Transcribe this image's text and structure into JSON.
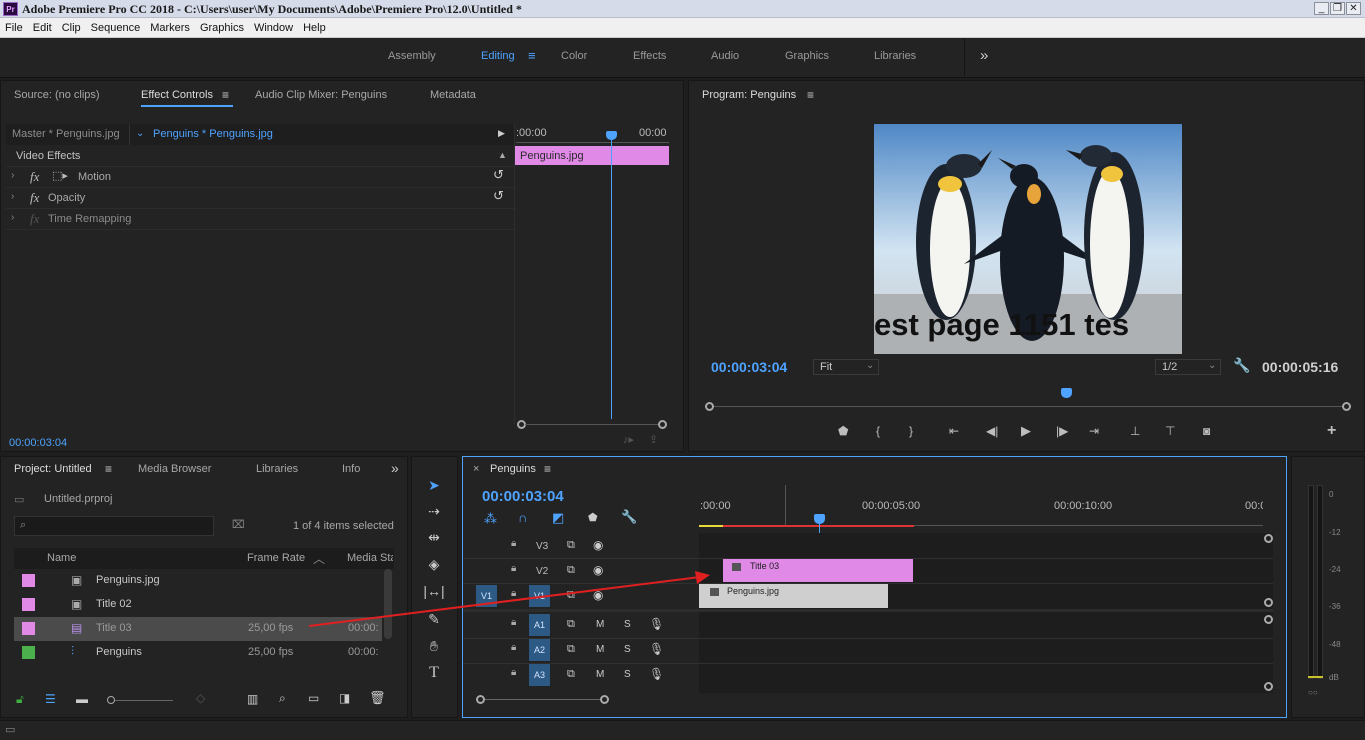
{
  "window": {
    "title": "Adobe Premiere Pro CC 2018 - C:\\Users\\user\\My Documents\\Adobe\\Premiere Pro\\12.0\\Untitled *",
    "logo": "Pr",
    "minimize": "_",
    "restore": "❐",
    "close": "✕"
  },
  "menu": [
    "File",
    "Edit",
    "Clip",
    "Sequence",
    "Markers",
    "Graphics",
    "Window",
    "Help"
  ],
  "workspaces": {
    "items": [
      "Assembly",
      "Editing",
      "Color",
      "Effects",
      "Audio",
      "Graphics",
      "Libraries"
    ],
    "active": "Editing",
    "more": "»"
  },
  "source_panel": {
    "tabs": [
      "Source: (no clips)",
      "Effect Controls",
      "Audio Clip Mixer: Penguins",
      "Metadata"
    ],
    "active_tab": "Effect Controls",
    "master": "Master * Penguins.jpg",
    "clip": "Penguins * Penguins.jpg",
    "section": "Video Effects",
    "effects": [
      "Motion",
      "Opacity",
      "Time Remapping"
    ],
    "fx": "fx",
    "ruler_start": ":00:00",
    "ruler_end": "00:00",
    "clip_bar": "Penguins.jpg",
    "timecode": "00:00:03:04"
  },
  "program": {
    "title": "Program: Penguins",
    "overlay_text": "est page 1151 tes",
    "current_time": "00:00:03:04",
    "fit": "Fit",
    "resolution": "1/2",
    "duration": "00:00:05:16",
    "playhead_fraction": 0.56
  },
  "project": {
    "tabs": [
      "Project: Untitled",
      "Media Browser",
      "Libraries",
      "Info"
    ],
    "more": "»",
    "file": "Untitled.prproj",
    "search_placeholder": "",
    "items_selected": "1 of 4 items selected",
    "columns": [
      "Name",
      "Frame Rate",
      "Media Sta"
    ],
    "rows": [
      {
        "name": "Penguins.jpg",
        "rate": "",
        "media": "",
        "color": "#e089e6"
      },
      {
        "name": "Title 02",
        "rate": "",
        "media": "",
        "color": "#e089e6"
      },
      {
        "name": "Title 03",
        "rate": "25,00 fps",
        "media": "00:00:",
        "color": "#e089e6"
      },
      {
        "name": "Penguins",
        "rate": "25,00 fps",
        "media": "00:00:",
        "color": "#4cb04c"
      }
    ]
  },
  "timeline": {
    "title": "Penguins",
    "timecode": "00:00:03:04",
    "ruler": [
      ":00:00",
      "00:00:05:00",
      "00:00:10:00",
      "00:0"
    ],
    "video_tracks": [
      "V3",
      "V2",
      "V1"
    ],
    "audio_tracks": [
      "A1",
      "A2",
      "A3"
    ],
    "source_patch": "V1",
    "clips": {
      "title": "Title 03",
      "penguins": "Penguins.jpg"
    },
    "mute": "M",
    "solo": "S"
  },
  "meter": {
    "labels": [
      "0",
      "-12",
      "-24",
      "-36",
      "-48",
      "dB"
    ]
  },
  "colors": {
    "accent": "#4ea3ff",
    "clip_pink": "#e089e6",
    "arrow": "#e02020"
  }
}
